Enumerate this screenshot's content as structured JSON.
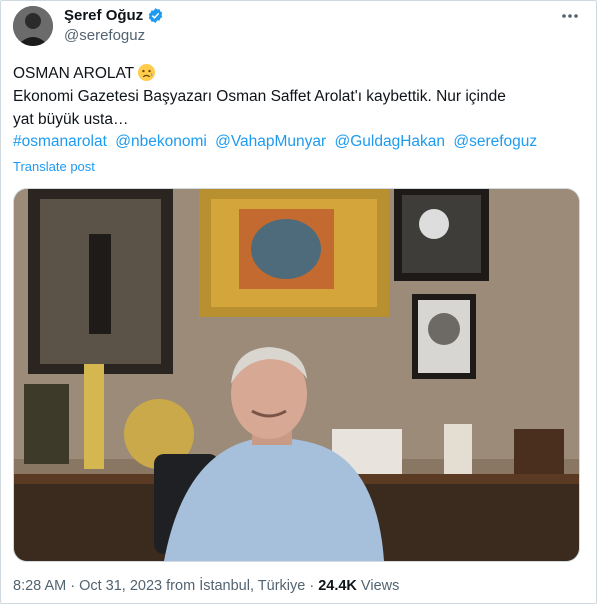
{
  "author": {
    "name": "Şeref Oğuz",
    "handle": "@serefoguz"
  },
  "tweet": {
    "line1": "OSMAN AROLAT",
    "line1_emoji": "sad-tear-face",
    "line2": "Ekonomi Gazetesi Başyazarı Osman Saffet Arolat'ı kaybettik. Nur içinde",
    "line3": "yat büyük usta…",
    "tags": [
      "#osmanarolat",
      "@nbekonomi",
      "@VahapMunyar",
      "@GuldagHakan",
      "@serefoguz"
    ],
    "translate_label": "Translate post"
  },
  "meta": {
    "time": "8:28 AM",
    "sep1": " · ",
    "date": "Oct 31, 2023",
    "from": " from ",
    "location": "İstanbul, Türkiye",
    "sep2": " · ",
    "views_count": "24.4K",
    "views_label": " Views"
  },
  "icons": {
    "verified": "verified-badge-icon",
    "more": "more-options-icon"
  },
  "colors": {
    "accent": "#1d9bf0",
    "text": "#0f1419",
    "muted": "#536471"
  }
}
